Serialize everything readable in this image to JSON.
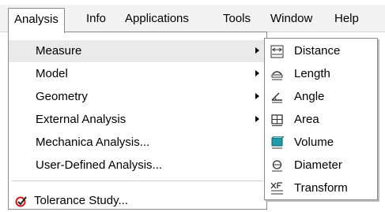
{
  "menubar": {
    "items": [
      {
        "label": "Analysis"
      },
      {
        "label": "Info"
      },
      {
        "label": "Applications"
      },
      {
        "label": "Tools"
      },
      {
        "label": "Window"
      },
      {
        "label": "Help"
      }
    ]
  },
  "analysis_menu": {
    "items": [
      {
        "label": "Measure",
        "has_submenu": true
      },
      {
        "label": "Model",
        "has_submenu": true
      },
      {
        "label": "Geometry",
        "has_submenu": true
      },
      {
        "label": "External Analysis",
        "has_submenu": true
      },
      {
        "label": "Mechanica Analysis..."
      },
      {
        "label": "User-Defined Analysis..."
      }
    ],
    "tolerance_item": {
      "label": "Tolerance Study...",
      "icon": "tolerance-study-icon"
    }
  },
  "measure_submenu": {
    "items": [
      {
        "label": "Distance",
        "icon": "distance-icon"
      },
      {
        "label": "Length",
        "icon": "length-icon"
      },
      {
        "label": "Angle",
        "icon": "angle-icon"
      },
      {
        "label": "Area",
        "icon": "area-icon"
      },
      {
        "label": "Volume",
        "icon": "volume-icon"
      },
      {
        "label": "Diameter",
        "icon": "diameter-icon"
      },
      {
        "label": "Transform",
        "icon": "transform-icon"
      }
    ]
  },
  "colors": {
    "menubar_bg": "#f3f3f3",
    "menu_border": "#8a8a8a",
    "volume_icon_accent": "#1f9aa6",
    "tolerance_icon_accent": "#cc1a1a"
  }
}
